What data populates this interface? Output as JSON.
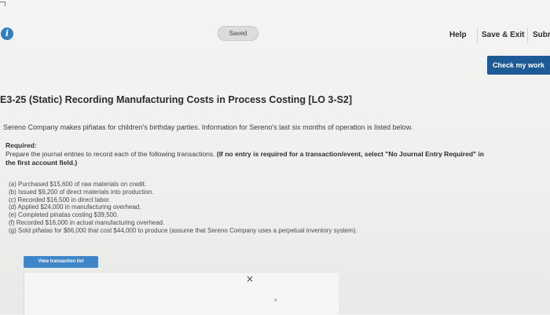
{
  "header": {
    "status_badge": "Saved",
    "help_label": "Help",
    "save_exit_label": "Save & Exit",
    "submit_label": "Subr",
    "check_label": "Check my work"
  },
  "problem": {
    "title": "E3-25 (Static) Recording Manufacturing Costs in Process Costing [LO 3-S2]",
    "intro": "Sereno Company makes piñatas for children's birthday parties. Information for Sereno's last six months of operation is listed below.",
    "required_label": "Required:",
    "instruction_plain": "Prepare the journal entries to record each of the following transactions.",
    "instruction_bold": "(If no entry is required for a transaction/event, select \"No Journal Entry Required\" in the first account field.)",
    "transactions": [
      "(a) Purchased $15,600 of raw materials on credit.",
      "(b) Issued $9,200 of direct materials into production.",
      "(c) Recorded $16,500 in direct labor.",
      "(d) Applied $24,000 in manufacturing overhead.",
      "(e) Completed pinatas costing $39,500.",
      "(f) Recorded $16,000 in actual manufacturing overhead.",
      "(g) Sold piñatas for $66,000 that cost $44,000 to produce (assume that Sereno Company uses a perpetual inventory system)."
    ],
    "view_button_label": "View transaction list"
  },
  "panel": {
    "close_glyph": "×"
  },
  "icons": {
    "info": "info-icon",
    "close": "close-icon"
  },
  "colors": {
    "check_button": "#1e5a95",
    "view_button": "#3e86c9",
    "info_icon": "#2f7fc1"
  }
}
